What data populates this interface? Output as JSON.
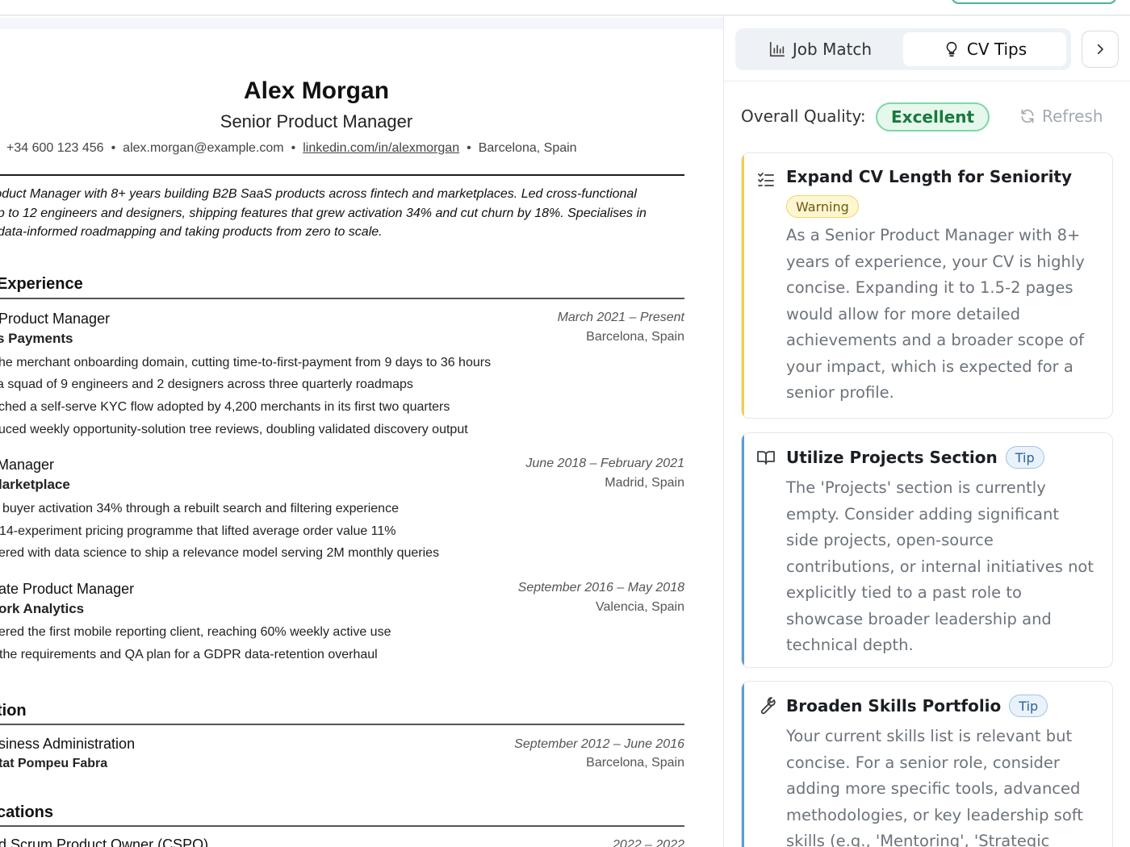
{
  "resume": {
    "name": "Alex Morgan",
    "headline": "Senior Product Manager",
    "contact": {
      "phone": "+34 600 123 456",
      "email": "alex.morgan@example.com",
      "linkedin": "linkedin.com/in/alexmorgan",
      "location": "Barcelona, Spain",
      "separator": "•"
    },
    "summary_lines": [
      "roduct Manager with 8+ years building B2B SaaS products across fintech and marketplaces. Led cross-functional",
      "up to 12 engineers and designers, shipping features that grew activation 34% and cut churn by 18%. Specialises in",
      ", data-informed roadmapping and taking products from zero to scale."
    ],
    "sections": {
      "experience": "Experience",
      "education": "tion",
      "certifications": "cations"
    },
    "jobs": [
      {
        "role": "Product Manager",
        "company": "s Payments",
        "dates": "March 2021 – Present",
        "location": "Barcelona, Spain",
        "bullets": [
          "he merchant onboarding domain, cutting time-to-first-payment from 9 days to 36 hours",
          "a squad of 9 engineers and 2 designers across three quarterly roadmaps",
          "ched a self-serve KYC flow adopted by 4,200 merchants in its first two quarters",
          "uced weekly opportunity-solution tree reviews, doubling validated discovery output"
        ]
      },
      {
        "role": "Manager",
        "company": "larketplace",
        "dates": "June 2018 – February 2021",
        "location": "Madrid, Spain",
        "bullets": [
          "buyer activation 34% through a rebuilt search and filtering experience",
          "14-experiment pricing programme that lifted average order value 11%",
          "ered with data science to ship a relevance model serving 2M monthly queries"
        ]
      },
      {
        "role": "ate Product Manager",
        "company": "ork Analytics",
        "dates": "September 2016 – May 2018",
        "location": "Valencia, Spain",
        "bullets": [
          "ered the first mobile reporting client, reaching 60% weekly active use",
          "the requirements and QA plan for a GDPR data-retention overhaul"
        ]
      }
    ],
    "education": {
      "degree": "siness Administration",
      "school": "tat Pompeu Fabra",
      "dates": "September 2012 – June 2016",
      "location": "Barcelona, Spain"
    },
    "certification": {
      "name": "d Scrum Product Owner (CSPO)",
      "dates": "2022 – 2022"
    }
  },
  "panel": {
    "tabs": [
      {
        "label": "Job Match",
        "icon": "bar-chart-icon",
        "active": false
      },
      {
        "label": "CV Tips",
        "icon": "lightbulb-icon",
        "active": true
      }
    ],
    "collapse_icon": "chevron-right-icon",
    "quality_label": "Overall Quality:",
    "quality_value": "Excellent",
    "refresh_label": "Refresh",
    "cards": [
      {
        "icon": "checklist-icon",
        "title": "Expand CV Length for Seniority",
        "badge": "Warning",
        "accent": "#f0cf4a",
        "body_lines": [
          "As a Senior Product Manager with 8+",
          "years of experience, your CV is highly",
          "concise. Expanding it to 1.5-2 pages",
          "would allow for more detailed",
          "achievements and a broader scope of",
          "your impact, which is expected for a",
          "senior profile."
        ]
      },
      {
        "icon": "book-icon",
        "title": "Utilize Projects Section",
        "badge": "Tip",
        "accent": "#5b9bd5",
        "body_lines": [
          "The 'Projects' section is currently",
          "empty. Consider adding significant",
          "side projects, open-source",
          "contributions, or internal initiatives not",
          "explicitly tied to a past role to",
          "showcase broader leadership and",
          "technical depth."
        ]
      },
      {
        "icon": "wrench-icon",
        "title": "Broaden Skills Portfolio",
        "badge": "Tip",
        "accent": "#5b9bd5",
        "body_lines": [
          "Your current skills list is relevant but",
          "concise. For a senior role, consider",
          "adding more specific tools, advanced",
          "methodologies, or key leadership soft",
          "skills (e.g., 'Mentoring', 'Strategic"
        ]
      }
    ]
  }
}
